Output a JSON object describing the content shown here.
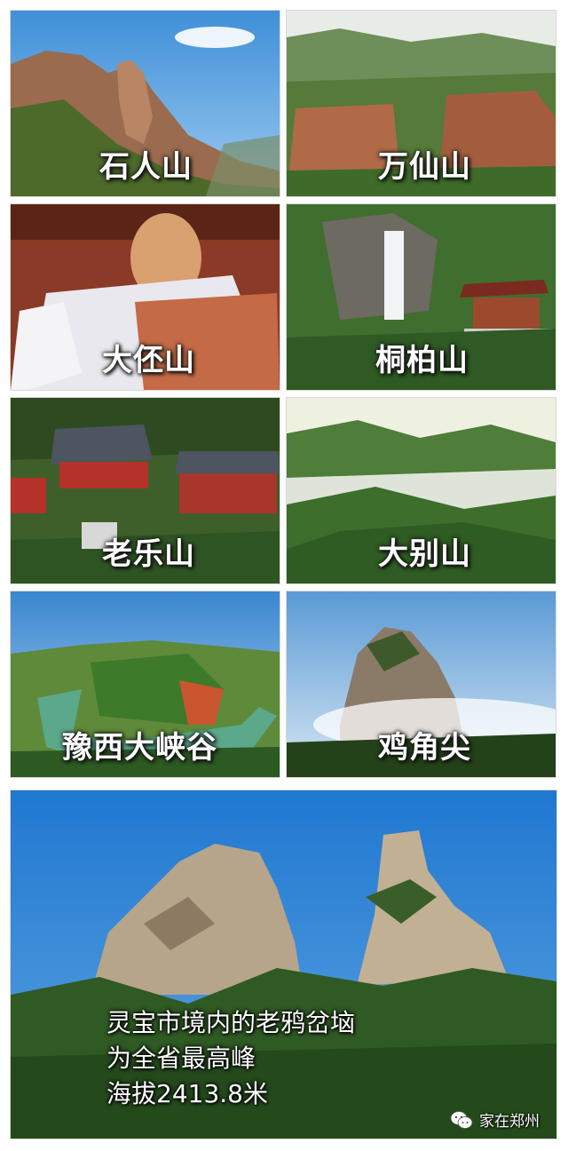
{
  "tiles": [
    {
      "label": "石人山"
    },
    {
      "label": "万仙山"
    },
    {
      "label": "大伾山"
    },
    {
      "label": "桐柏山"
    },
    {
      "label": "老乐山"
    },
    {
      "label": "大别山"
    },
    {
      "label": "豫西大峡谷"
    },
    {
      "label": "鸡角尖"
    }
  ],
  "feature": {
    "lines": [
      "灵宝市境内的老鸦岔垴",
      "为全省最高峰",
      "海拔2413.8米"
    ]
  },
  "watermark": {
    "text": "家在郑州",
    "icon": "wechat-icon"
  },
  "colors": {
    "sky": "#3f8fd8",
    "forest": "#2f5e24",
    "rock": "#a07a5c",
    "label": "#ffffff"
  }
}
